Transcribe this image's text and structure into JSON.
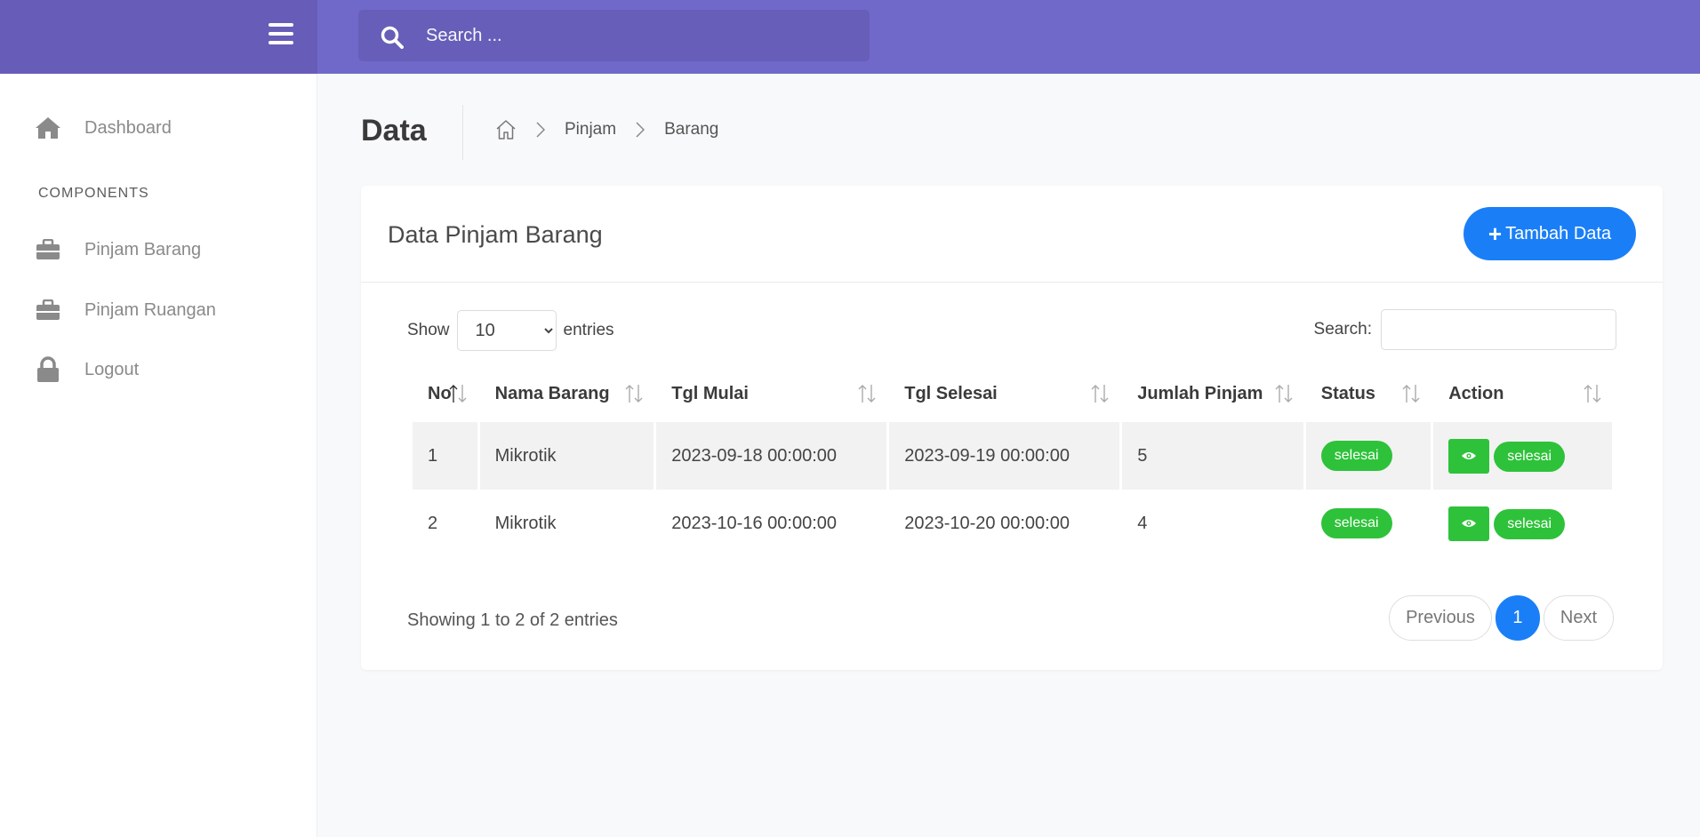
{
  "header": {
    "search_placeholder": "Search ..."
  },
  "sidebar": {
    "items": [
      {
        "label": "Dashboard",
        "icon": "home-icon"
      },
      {
        "label": "Pinjam Barang",
        "icon": "briefcase-icon"
      },
      {
        "label": "Pinjam Ruangan",
        "icon": "briefcase-icon"
      },
      {
        "label": "Logout",
        "icon": "lock-icon"
      }
    ],
    "section_heading": "COMPONENTS"
  },
  "page": {
    "title": "Data",
    "breadcrumb": [
      "Pinjam",
      "Barang"
    ]
  },
  "card": {
    "title": "Data Pinjam Barang",
    "add_button": "Tambah Data",
    "show_label": "Show",
    "entries_label": "entries",
    "page_size": "10",
    "search_label": "Search:"
  },
  "table": {
    "columns": [
      "No",
      "Nama Barang",
      "Tgl Mulai",
      "Tgl Selesai",
      "Jumlah Pinjam",
      "Status",
      "Action"
    ],
    "rows": [
      {
        "no": "1",
        "nama": "Mikrotik",
        "mulai": "2023-09-18 00:00:00",
        "selesai": "2023-09-19 00:00:00",
        "jumlah": "5",
        "status": "selesai",
        "action": "selesai"
      },
      {
        "no": "2",
        "nama": "Mikrotik",
        "mulai": "2023-10-16 00:00:00",
        "selesai": "2023-10-20 00:00:00",
        "jumlah": "4",
        "status": "selesai",
        "action": "selesai"
      }
    ]
  },
  "footer": {
    "info": "Showing 1 to 2 of 2 entries",
    "previous": "Previous",
    "current_page": "1",
    "next": "Next"
  },
  "colors": {
    "topbar": "#7169c9",
    "brand": "#675db8",
    "primary": "#1a7ff7",
    "success": "#2ec23a"
  }
}
